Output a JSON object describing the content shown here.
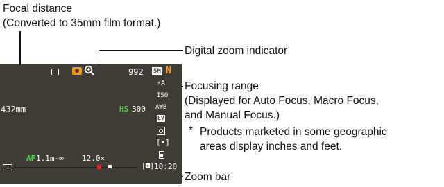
{
  "annotations": {
    "focal_distance": "Focal distance",
    "focal_distance_note": "(Converted to 35mm film format.)",
    "digital_zoom": "Digital zoom indicator",
    "focusing_range": "Focusing range",
    "focusing_range_note1": "(Displayed for Auto Focus, Macro Focus,",
    "focusing_range_note2": "and Manual Focus.)",
    "footnote_mark": "*",
    "footnote1": "Products marketed in some geographic",
    "footnote2": "areas display inches and feet.",
    "zoom_bar": "Zoom bar"
  },
  "screen": {
    "shots_remaining": "992",
    "size_badge": "5M",
    "quality": "N",
    "flash": "⚡A",
    "focal_mm": "432mm",
    "hs": "HS",
    "shutter": "300",
    "iso": "ISO",
    "awb": "AWB",
    "ev": "EV",
    "time": "10:20",
    "af": "AF",
    "focus_range": "1.1m-∞",
    "zoom": "12.0×"
  },
  "colors": {
    "screen_bg": "#3e3c35",
    "osd_text": "#ffffff",
    "af_green": "#44dd44",
    "zoom_orange": "#ff9900",
    "zoom_bar_red": "#ee2222"
  }
}
